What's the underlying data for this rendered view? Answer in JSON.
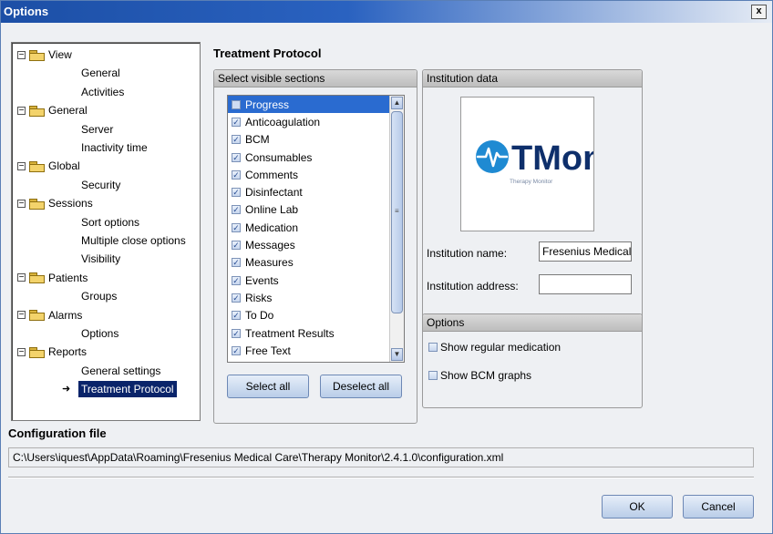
{
  "window": {
    "title": "Options",
    "close_glyph": "x"
  },
  "tree": {
    "groups": [
      {
        "label": "View",
        "expander": "⊟",
        "children": [
          "General",
          "Activities"
        ]
      },
      {
        "label": "General",
        "expander": "⊟",
        "children": [
          "Server",
          "Inactivity time"
        ]
      },
      {
        "label": "Global",
        "expander": "⊟",
        "children": [
          "Security"
        ]
      },
      {
        "label": "Sessions",
        "expander": "⊟",
        "children": [
          "Sort options",
          "Multiple close options",
          "Visibility"
        ]
      },
      {
        "label": "Patients",
        "expander": "⊟",
        "children": [
          "Groups"
        ]
      },
      {
        "label": "Alarms",
        "expander": "⊟",
        "children": [
          "Options"
        ]
      },
      {
        "label": "Reports",
        "expander": "⊟",
        "children": [
          "General settings",
          "Treatment Protocol"
        ]
      }
    ],
    "selected": "Treatment Protocol",
    "selected_marker_icon": "arrow-right-icon"
  },
  "main": {
    "title": "Treatment Protocol",
    "sections_group": {
      "header": "Select visible sections",
      "items": [
        {
          "label": "Progress",
          "checked": false,
          "selected": true
        },
        {
          "label": "Anticoagulation",
          "checked": true
        },
        {
          "label": "BCM",
          "checked": true
        },
        {
          "label": "Consumables",
          "checked": true
        },
        {
          "label": "Comments",
          "checked": true
        },
        {
          "label": "Disinfectant",
          "checked": true
        },
        {
          "label": "Online Lab",
          "checked": true
        },
        {
          "label": "Medication",
          "checked": true
        },
        {
          "label": "Messages",
          "checked": true
        },
        {
          "label": "Measures",
          "checked": true
        },
        {
          "label": "Events",
          "checked": true
        },
        {
          "label": "Risks",
          "checked": true
        },
        {
          "label": "To Do",
          "checked": true
        },
        {
          "label": "Treatment Results",
          "checked": true
        },
        {
          "label": "Free Text",
          "checked": true
        }
      ],
      "select_all_label": "Select all",
      "deselect_all_label": "Deselect all"
    },
    "institution_group": {
      "header": "Institution data",
      "logo_text": "TMon",
      "logo_subtext": "Therapy Monitor",
      "name_label": "Institution name:",
      "name_value": "Fresenius Medical C",
      "address_label": "Institution address:",
      "address_value": ""
    },
    "options_group": {
      "header": "Options",
      "show_regular_medication_label": "Show regular medication",
      "show_regular_medication_checked": false,
      "show_bcm_graphs_label": "Show BCM graphs",
      "show_bcm_graphs_checked": false
    }
  },
  "config": {
    "title": "Configuration file",
    "path": "C:\\Users\\iquest\\AppData\\Roaming\\Fresenius Medical Care\\Therapy Monitor\\2.4.1.0\\configuration.xml"
  },
  "footer": {
    "ok_label": "OK",
    "cancel_label": "Cancel"
  },
  "colors": {
    "accent": "#2a6bd0",
    "titlebar": "#1c4fa6",
    "logo_blue": "#1f8ad2",
    "logo_dark": "#0e2f6b"
  }
}
